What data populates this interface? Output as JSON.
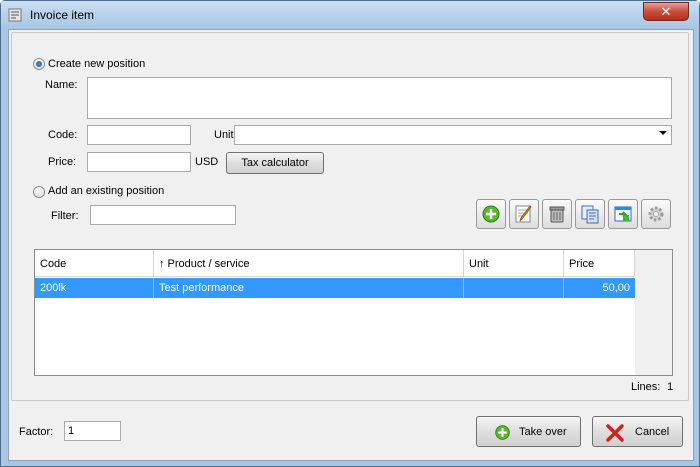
{
  "window": {
    "title": "Invoice item",
    "close_label": "✕"
  },
  "new_position": {
    "radio_label": "Create new position",
    "selected": true,
    "name_label": "Name:",
    "name_value": "",
    "code_label": "Code:",
    "code_value": "",
    "unit_label": "Unit:",
    "unit_value": "",
    "price_label": "Price:",
    "price_value": "",
    "currency": "USD",
    "tax_calculator_label": "Tax calculator"
  },
  "existing_position": {
    "radio_label": "Add an existing position",
    "selected": false,
    "filter_label": "Filter:",
    "filter_value": ""
  },
  "toolbar": {
    "icons": [
      "add-icon",
      "edit-icon",
      "trash-icon",
      "copy-icon",
      "import-icon",
      "settings-icon"
    ]
  },
  "table": {
    "columns": [
      "Code",
      "↑ Product / service",
      "Unit",
      "Price"
    ],
    "rows": [
      {
        "code": "200lk",
        "product": "Test performance",
        "unit": "",
        "price": "50,00",
        "selected": true
      }
    ],
    "lines_label": "Lines:",
    "lines_count": "1"
  },
  "footer": {
    "factor_label": "Factor:",
    "factor_value": "1",
    "take_over_label": "Take over",
    "cancel_label": "Cancel"
  },
  "colors": {
    "selection": "#3399ff",
    "frame": "#a8c6e4",
    "close": "#c7503b"
  }
}
